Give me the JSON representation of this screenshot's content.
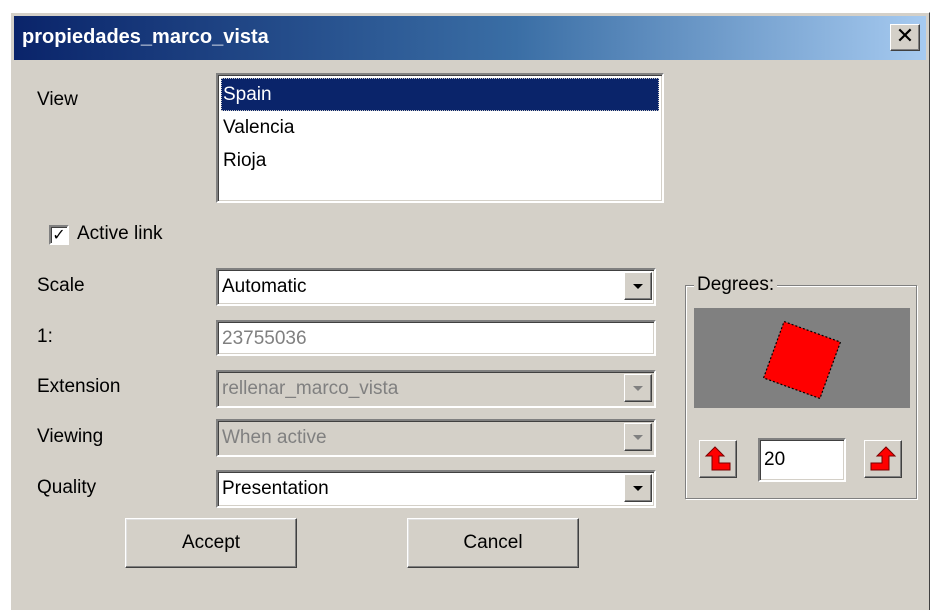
{
  "window": {
    "title": "propiedades_marco_vista",
    "close_label": "✕"
  },
  "view": {
    "label": "View",
    "items": [
      {
        "label": "Spain",
        "selected": true
      },
      {
        "label": "Valencia",
        "selected": false
      },
      {
        "label": "Rioja",
        "selected": false
      }
    ]
  },
  "active_link": {
    "label": "Active link",
    "checked": true
  },
  "scale": {
    "label": "Scale",
    "value": "Automatic"
  },
  "ratio": {
    "label": "1:",
    "value": "23755036"
  },
  "extension": {
    "label": "Extension",
    "value": "rellenar_marco_vista"
  },
  "viewing": {
    "label": "Viewing",
    "value": "When active"
  },
  "quality": {
    "label": "Quality",
    "value": "Presentation"
  },
  "buttons": {
    "accept": "Accept",
    "cancel": "Cancel"
  },
  "degrees": {
    "label": "Degrees:",
    "value": "20",
    "preview_color": "#ff0000",
    "preview_background": "#808080",
    "rotate_left_icon": "rotate-left-arrow",
    "rotate_right_icon": "rotate-right-arrow"
  }
}
